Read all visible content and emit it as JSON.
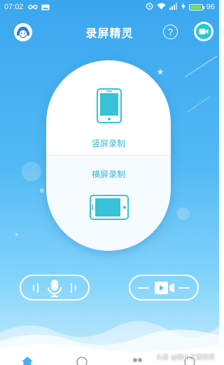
{
  "status_bar": {
    "time": "07:02",
    "battery": "96",
    "battery_level": 0.96,
    "icons": [
      "infinity-icon",
      "image-icon",
      "alarm-icon",
      "wifi-icon",
      "signal-icon",
      "charging-icon",
      "battery-icon"
    ]
  },
  "header": {
    "title": "录屏精灵",
    "help_label": "?"
  },
  "record_card": {
    "portrait_label": "竖屏录制",
    "landscape_label": "横屏录制"
  },
  "controls": {
    "audio_icon": "microphone-icon",
    "video_icon": "video-camera-icon"
  },
  "tabbar": {
    "icons": [
      "home-icon",
      "clock-icon",
      "people-icon",
      "profile-icon"
    ]
  },
  "watermark": "头条 @随小王观世界",
  "colors": {
    "accent": "#38b8d6",
    "background_top": "#3aa6ee",
    "cam_button": "#28c8cf"
  }
}
